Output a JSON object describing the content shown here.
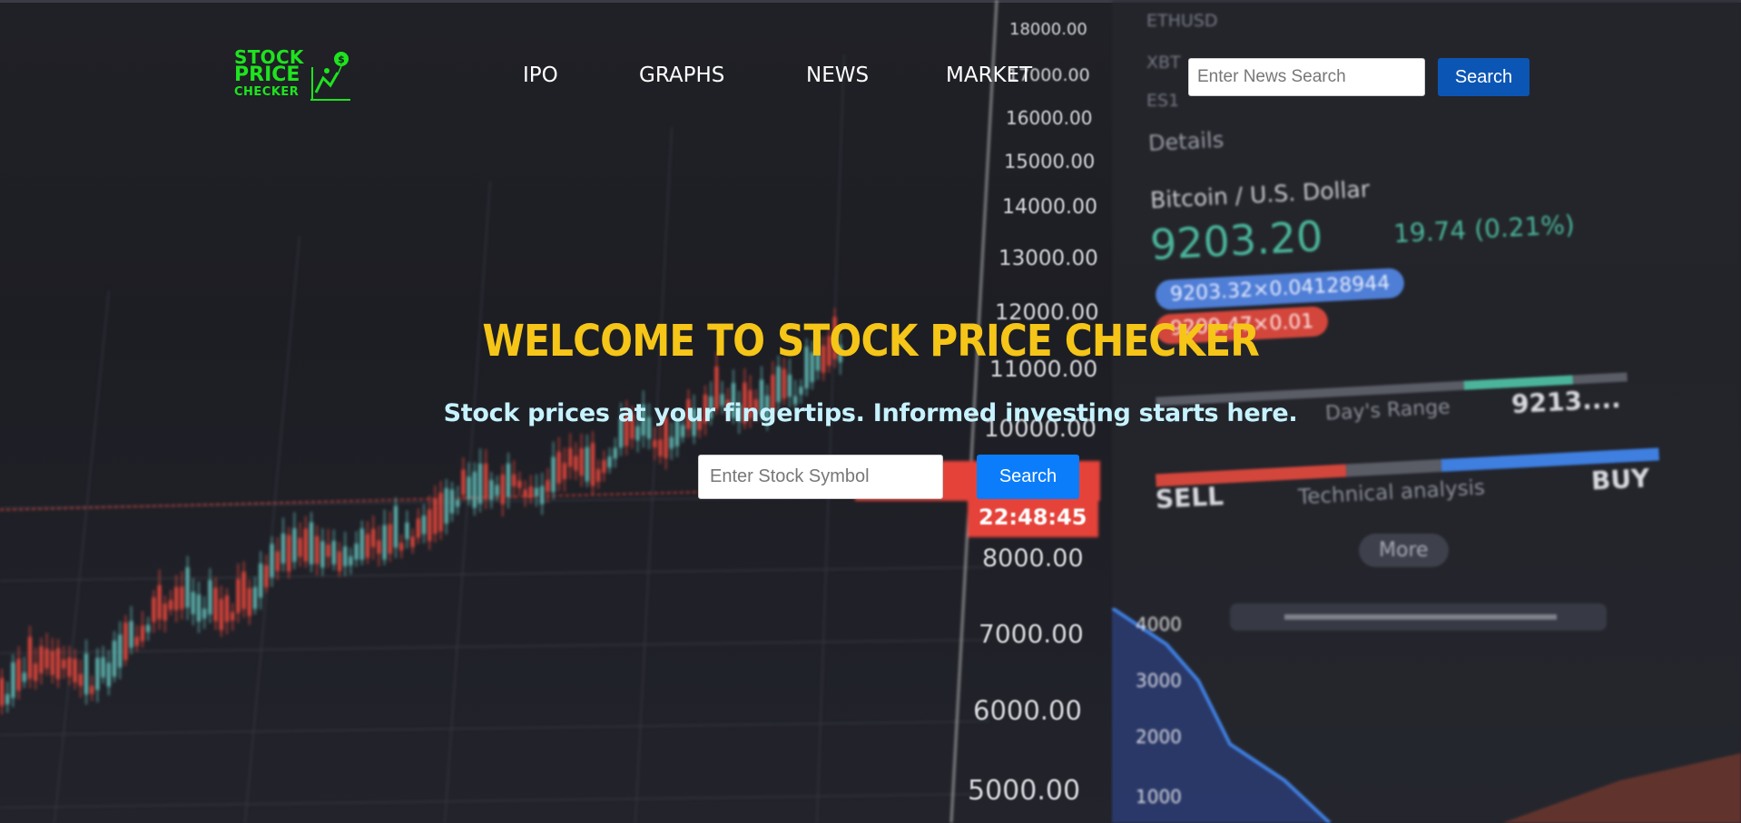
{
  "brand": {
    "logo_line1": "STOCK",
    "logo_line2": "PRICE",
    "logo_line3": "CHECKER",
    "logo_icon": "chart-person-dollar-icon",
    "logo_color": "#1fe31f"
  },
  "nav": {
    "items": [
      {
        "label": "IPO"
      },
      {
        "label": "GRAPHS"
      },
      {
        "label": "NEWS"
      },
      {
        "label": "MARKET"
      }
    ]
  },
  "news_search": {
    "placeholder": "Enter News Search",
    "value": "",
    "button_label": "Search",
    "button_color": "#0b56b4"
  },
  "hero": {
    "title": "WELCOME TO STOCK PRICE CHECKER",
    "title_color": "#f5c518",
    "subtitle": "Stock prices at your fingertips. Informed investing starts here.",
    "subtitle_color": "#c6f3ff"
  },
  "stock_search": {
    "placeholder": "Enter Stock Symbol",
    "value": "",
    "button_label": "Search",
    "button_color": "#0b7dfa"
  },
  "background": {
    "price_axis": [
      "18000.00",
      "17000.00",
      "16000.00",
      "15000.00",
      "14000.00",
      "13000.00",
      "12000.00",
      "11000.00",
      "10000.00",
      "8000.00",
      "7000.00",
      "6000.00",
      "5000.00"
    ],
    "time_label": "22:48:45",
    "ticker_rows": [
      "ETHUSD",
      "XBT",
      "ES1"
    ],
    "details_label": "Details",
    "pair_name": "Bitcoin / U.S. Dollar",
    "pair_price": "9203.20",
    "pair_change": "19.74 (0.21%)",
    "bid_pill": "9203.32×0.04128944",
    "ask_pill": "9209.47×0.01",
    "days_range_label": "Day's Range",
    "days_range_value": "9213....",
    "sell_label": "SELL",
    "technical_label": "Technical analysis",
    "buy_label": "BUY",
    "more_label": "More",
    "depth_axis": [
      "4000",
      "3000",
      "2000",
      "1000"
    ]
  }
}
